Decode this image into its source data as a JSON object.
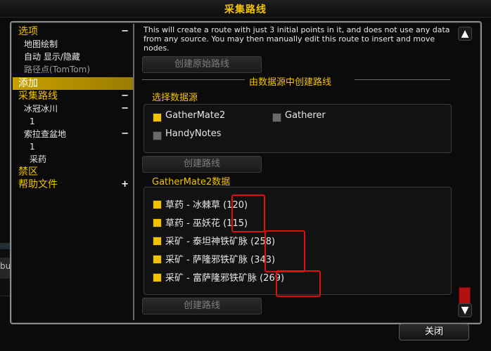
{
  "window": {
    "title": "采集路线"
  },
  "sidebar": {
    "items": [
      {
        "label": "选项",
        "toggle": "−"
      },
      {
        "label": "地图绘制"
      },
      {
        "label": "自动 显示/隐藏"
      },
      {
        "label": "路径点(TomTom)"
      },
      {
        "label": "添加"
      },
      {
        "label": "采集路线",
        "toggle": "−"
      },
      {
        "label": "冰冠冰川",
        "toggle": "−"
      },
      {
        "label": "1"
      },
      {
        "label": "索拉查盆地",
        "toggle": "−"
      },
      {
        "label": "1"
      },
      {
        "label": "采药"
      },
      {
        "label": "禁区"
      },
      {
        "label": "帮助文件",
        "toggle": "+"
      }
    ]
  },
  "main": {
    "description": "This will create a route with just 3 initial points in it, and does not use any data from any source. You may then manually edit this route to insert and move nodes.",
    "create_original_button": "创建原始路线",
    "from_source_header": "由数据源中创建路线",
    "select_source": {
      "title": "选择数据源",
      "options": [
        {
          "label": "GatherMate2",
          "checked": true
        },
        {
          "label": "Gatherer",
          "checked": false
        },
        {
          "label": "HandyNotes",
          "checked": false
        }
      ]
    },
    "create_route_button_1": "创建路线",
    "gathermate_section": {
      "title": "GatherMate2数据",
      "items": [
        {
          "name": "草药 - 冰棘草",
          "count": "(120)",
          "checked": true
        },
        {
          "name": "草药 - 巫妖花",
          "count": "(115)",
          "checked": true
        },
        {
          "name": "采矿 - 泰坦神铁矿脉",
          "count": "(258)",
          "checked": true
        },
        {
          "name": "采矿 - 萨隆邪铁矿脉",
          "count": "(343)",
          "checked": true
        },
        {
          "name": "采矿 - 富萨隆邪铁矿脉",
          "count": "(269)",
          "checked": true
        }
      ]
    },
    "create_route_button_2": "创建路线"
  },
  "footer": {
    "close_button": "关闭"
  },
  "background": {
    "side_text": "bulker"
  },
  "colors": {
    "accent": "#f2c200",
    "highlight": "#e01010",
    "scroll_thumb": "#b11111"
  },
  "icons": {
    "scroll_up": "▲",
    "scroll_down": "▼"
  }
}
